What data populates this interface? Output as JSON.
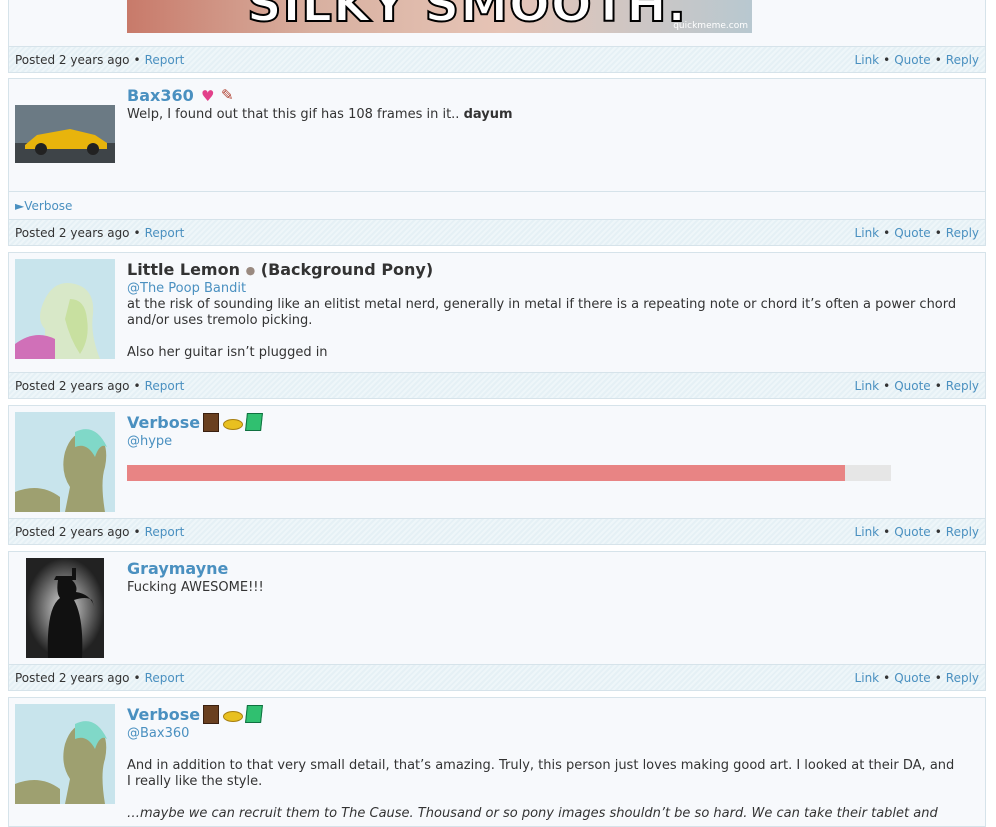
{
  "top_image": {
    "caption": "SILKY SMOOTH.",
    "watermark": "quickmeme.com"
  },
  "footer": {
    "posted": "Posted 2 years ago",
    "report": "Report",
    "link": "Link",
    "quote": "Quote",
    "reply": "Reply",
    "bullet": "•"
  },
  "posts": [
    {
      "author": "Bax360",
      "text": "Welp, I found out that this gif has 108 frames in it.. ",
      "bold": "dayum",
      "spoiler_label": "Verbose"
    },
    {
      "author": "Little Lemon",
      "status_dot": "●",
      "tag": "(Background Pony)",
      "mention": "@The Poop Bandit",
      "line1": "at the risk of sounding like an elitist metal nerd, generally in metal if there is a repeating note or chord it’s often a power chord and/or uses tremolo picking.",
      "line2": "Also her guitar isn’t plugged in"
    },
    {
      "author": "Verbose",
      "mention": "@hype",
      "embed_fill": 0.94
    },
    {
      "author": "Graymayne",
      "text": "Fucking AWESOME!!!"
    },
    {
      "author": "Verbose",
      "mention": "@Bax360",
      "line1": "And in addition to that very small detail, that’s amazing. Truly, this person just loves making good art. I looked at their DA, and I really like the style.",
      "line2": "…maybe we can recruit them to The Cause. Thousand or so pony images shouldn’t be so hard. We can take their tablet and"
    }
  ],
  "colors": {
    "link": "#4a90c0",
    "border": "#d6e3ea",
    "embed_bar": "#e88484"
  }
}
